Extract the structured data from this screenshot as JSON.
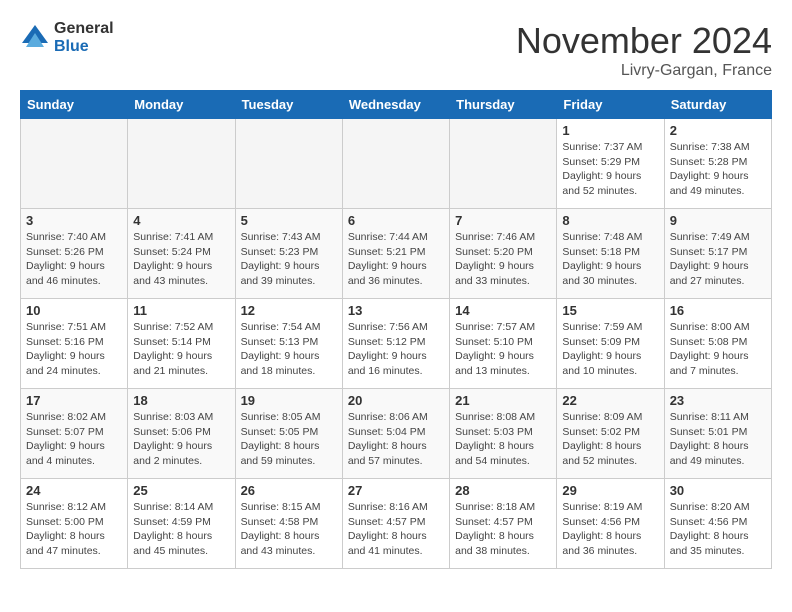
{
  "logo": {
    "general": "General",
    "blue": "Blue"
  },
  "title": "November 2024",
  "location": "Livry-Gargan, France",
  "days_of_week": [
    "Sunday",
    "Monday",
    "Tuesday",
    "Wednesday",
    "Thursday",
    "Friday",
    "Saturday"
  ],
  "weeks": [
    [
      {
        "day": "",
        "info": ""
      },
      {
        "day": "",
        "info": ""
      },
      {
        "day": "",
        "info": ""
      },
      {
        "day": "",
        "info": ""
      },
      {
        "day": "",
        "info": ""
      },
      {
        "day": "1",
        "info": "Sunrise: 7:37 AM\nSunset: 5:29 PM\nDaylight: 9 hours\nand 52 minutes."
      },
      {
        "day": "2",
        "info": "Sunrise: 7:38 AM\nSunset: 5:28 PM\nDaylight: 9 hours\nand 49 minutes."
      }
    ],
    [
      {
        "day": "3",
        "info": "Sunrise: 7:40 AM\nSunset: 5:26 PM\nDaylight: 9 hours\nand 46 minutes."
      },
      {
        "day": "4",
        "info": "Sunrise: 7:41 AM\nSunset: 5:24 PM\nDaylight: 9 hours\nand 43 minutes."
      },
      {
        "day": "5",
        "info": "Sunrise: 7:43 AM\nSunset: 5:23 PM\nDaylight: 9 hours\nand 39 minutes."
      },
      {
        "day": "6",
        "info": "Sunrise: 7:44 AM\nSunset: 5:21 PM\nDaylight: 9 hours\nand 36 minutes."
      },
      {
        "day": "7",
        "info": "Sunrise: 7:46 AM\nSunset: 5:20 PM\nDaylight: 9 hours\nand 33 minutes."
      },
      {
        "day": "8",
        "info": "Sunrise: 7:48 AM\nSunset: 5:18 PM\nDaylight: 9 hours\nand 30 minutes."
      },
      {
        "day": "9",
        "info": "Sunrise: 7:49 AM\nSunset: 5:17 PM\nDaylight: 9 hours\nand 27 minutes."
      }
    ],
    [
      {
        "day": "10",
        "info": "Sunrise: 7:51 AM\nSunset: 5:16 PM\nDaylight: 9 hours\nand 24 minutes."
      },
      {
        "day": "11",
        "info": "Sunrise: 7:52 AM\nSunset: 5:14 PM\nDaylight: 9 hours\nand 21 minutes."
      },
      {
        "day": "12",
        "info": "Sunrise: 7:54 AM\nSunset: 5:13 PM\nDaylight: 9 hours\nand 18 minutes."
      },
      {
        "day": "13",
        "info": "Sunrise: 7:56 AM\nSunset: 5:12 PM\nDaylight: 9 hours\nand 16 minutes."
      },
      {
        "day": "14",
        "info": "Sunrise: 7:57 AM\nSunset: 5:10 PM\nDaylight: 9 hours\nand 13 minutes."
      },
      {
        "day": "15",
        "info": "Sunrise: 7:59 AM\nSunset: 5:09 PM\nDaylight: 9 hours\nand 10 minutes."
      },
      {
        "day": "16",
        "info": "Sunrise: 8:00 AM\nSunset: 5:08 PM\nDaylight: 9 hours\nand 7 minutes."
      }
    ],
    [
      {
        "day": "17",
        "info": "Sunrise: 8:02 AM\nSunset: 5:07 PM\nDaylight: 9 hours\nand 4 minutes."
      },
      {
        "day": "18",
        "info": "Sunrise: 8:03 AM\nSunset: 5:06 PM\nDaylight: 9 hours\nand 2 minutes."
      },
      {
        "day": "19",
        "info": "Sunrise: 8:05 AM\nSunset: 5:05 PM\nDaylight: 8 hours\nand 59 minutes."
      },
      {
        "day": "20",
        "info": "Sunrise: 8:06 AM\nSunset: 5:04 PM\nDaylight: 8 hours\nand 57 minutes."
      },
      {
        "day": "21",
        "info": "Sunrise: 8:08 AM\nSunset: 5:03 PM\nDaylight: 8 hours\nand 54 minutes."
      },
      {
        "day": "22",
        "info": "Sunrise: 8:09 AM\nSunset: 5:02 PM\nDaylight: 8 hours\nand 52 minutes."
      },
      {
        "day": "23",
        "info": "Sunrise: 8:11 AM\nSunset: 5:01 PM\nDaylight: 8 hours\nand 49 minutes."
      }
    ],
    [
      {
        "day": "24",
        "info": "Sunrise: 8:12 AM\nSunset: 5:00 PM\nDaylight: 8 hours\nand 47 minutes."
      },
      {
        "day": "25",
        "info": "Sunrise: 8:14 AM\nSunset: 4:59 PM\nDaylight: 8 hours\nand 45 minutes."
      },
      {
        "day": "26",
        "info": "Sunrise: 8:15 AM\nSunset: 4:58 PM\nDaylight: 8 hours\nand 43 minutes."
      },
      {
        "day": "27",
        "info": "Sunrise: 8:16 AM\nSunset: 4:57 PM\nDaylight: 8 hours\nand 41 minutes."
      },
      {
        "day": "28",
        "info": "Sunrise: 8:18 AM\nSunset: 4:57 PM\nDaylight: 8 hours\nand 38 minutes."
      },
      {
        "day": "29",
        "info": "Sunrise: 8:19 AM\nSunset: 4:56 PM\nDaylight: 8 hours\nand 36 minutes."
      },
      {
        "day": "30",
        "info": "Sunrise: 8:20 AM\nSunset: 4:56 PM\nDaylight: 8 hours\nand 35 minutes."
      }
    ]
  ]
}
